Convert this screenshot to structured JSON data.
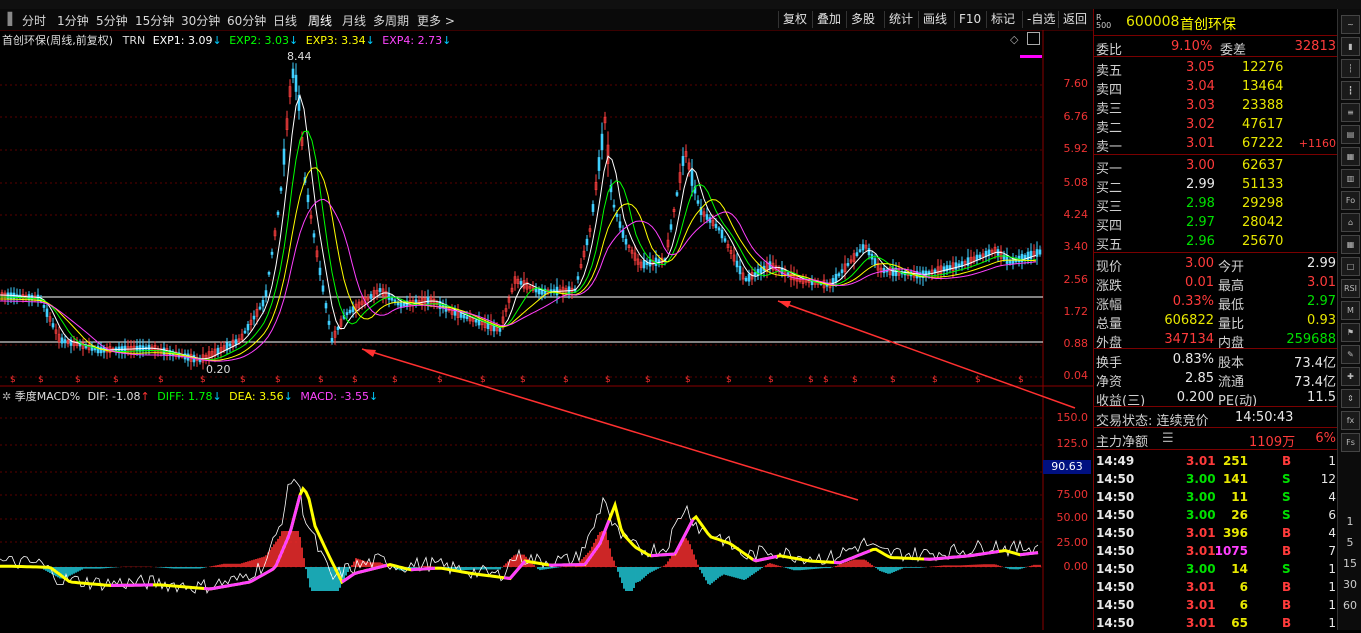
{
  "toolbar": {
    "periods": [
      "分时",
      "1分钟",
      "5分钟",
      "15分钟",
      "30分钟",
      "60分钟",
      "日线",
      "周线",
      "月线",
      "多周期",
      "更多 >"
    ],
    "active_period": "周线",
    "right_buttons": [
      "复权",
      "叠加",
      "多股",
      "统计",
      "画线",
      "F10",
      "标记",
      "-自选",
      "返回"
    ]
  },
  "main_legend": {
    "title": "首创环保(周线,前复权)",
    "indicator": "TRN",
    "exp1": "EXP1: 3.09",
    "exp2": "EXP2: 3.03",
    "exp3": "EXP3: 3.34",
    "exp4": "EXP4: 2.73"
  },
  "price_axis": [
    "7.60",
    "6.76",
    "5.92",
    "5.08",
    "4.24",
    "3.40",
    "2.56",
    "1.72",
    "0.88",
    "0.04"
  ],
  "high_label": "8.44",
  "low_label": "0.20",
  "macd_legend": {
    "title": "季度MACD%",
    "dif": "DIF: -1.08",
    "diff": "DIFF: 1.78",
    "dea": "DEA: 3.56",
    "macd": "MACD: -3.55"
  },
  "macd_axis": [
    "150.0",
    "125.0",
    "100.0",
    "75.00",
    "50.00",
    "25.00",
    "0.00"
  ],
  "macd_value_box": "90.63",
  "colors": {
    "up": "#ff3b3b",
    "down": "#00e000",
    "accent": "#ff40ff",
    "exp1": "#ffffff",
    "exp2": "#00ff00",
    "exp3": "#ffff00",
    "exp4": "#ff40ff"
  },
  "quote": {
    "code": "600008",
    "name": "首创环保",
    "weibi_label": "委比",
    "weibi": "9.10%",
    "weicha_label": "委差",
    "weicha": "32813",
    "asks": [
      {
        "label": "卖五",
        "price": "3.05",
        "vol": "12276",
        "delta": ""
      },
      {
        "label": "卖四",
        "price": "3.04",
        "vol": "13464",
        "delta": ""
      },
      {
        "label": "卖三",
        "price": "3.03",
        "vol": "23388",
        "delta": ""
      },
      {
        "label": "卖二",
        "price": "3.02",
        "vol": "47617",
        "delta": ""
      },
      {
        "label": "卖一",
        "price": "3.01",
        "vol": "67222",
        "delta": "+1160"
      }
    ],
    "bids": [
      {
        "label": "买一",
        "price": "3.00",
        "vol": "62637"
      },
      {
        "label": "买二",
        "price": "2.99",
        "vol": "51133"
      },
      {
        "label": "买三",
        "price": "2.98",
        "vol": "29298"
      },
      {
        "label": "买四",
        "price": "2.97",
        "vol": "28042"
      },
      {
        "label": "买五",
        "price": "2.96",
        "vol": "25670"
      }
    ],
    "stats": [
      {
        "l1": "现价",
        "v1": "3.00",
        "l2": "今开",
        "v2": "2.99"
      },
      {
        "l1": "涨跌",
        "v1": "0.01",
        "l2": "最高",
        "v2": "3.01"
      },
      {
        "l1": "涨幅",
        "v1": "0.33%",
        "l2": "最低",
        "v2": "2.97"
      },
      {
        "l1": "总量",
        "v1": "606822",
        "l2": "量比",
        "v2": "0.93"
      },
      {
        "l1": "外盘",
        "v1": "347134",
        "l2": "内盘",
        "v2": "259688"
      }
    ],
    "fund": [
      {
        "l1": "换手",
        "v1": "0.83%",
        "l2": "股本",
        "v2": "73.4亿"
      },
      {
        "l1": "净资",
        "v1": "2.85",
        "l2": "流通",
        "v2": "73.4亿"
      },
      {
        "l1": "收益(三)",
        "v1": "0.200",
        "l2": "PE(动)",
        "v2": "11.5"
      }
    ],
    "trade_state_label": "交易状态: 连续竞价",
    "trade_time": "14:50:43",
    "main_net_label": "主力净额",
    "main_net_value": "1109万",
    "main_net_pct": "6%"
  },
  "ticks": [
    {
      "time": "14:49",
      "price": "3.01",
      "vol": "251",
      "side": "B",
      "n": "1"
    },
    {
      "time": "14:50",
      "price": "3.00",
      "vol": "141",
      "side": "S",
      "n": "12"
    },
    {
      "time": "14:50",
      "price": "3.00",
      "vol": "11",
      "side": "S",
      "n": "4"
    },
    {
      "time": "14:50",
      "price": "3.00",
      "vol": "26",
      "side": "S",
      "n": "6"
    },
    {
      "time": "14:50",
      "price": "3.01",
      "vol": "396",
      "side": "B",
      "n": "4"
    },
    {
      "time": "14:50",
      "price": "3.01",
      "vol": "1075",
      "side": "B",
      "n": "7"
    },
    {
      "time": "14:50",
      "price": "3.00",
      "vol": "14",
      "side": "S",
      "n": "1"
    },
    {
      "time": "14:50",
      "price": "3.01",
      "vol": "6",
      "side": "B",
      "n": "1"
    },
    {
      "time": "14:50",
      "price": "3.01",
      "vol": "6",
      "side": "B",
      "n": "1"
    },
    {
      "time": "14:50",
      "price": "3.01",
      "vol": "65",
      "side": "B",
      "n": "1"
    }
  ],
  "sidebar_numbers": [
    "1",
    "5",
    "15",
    "30",
    "60"
  ]
}
